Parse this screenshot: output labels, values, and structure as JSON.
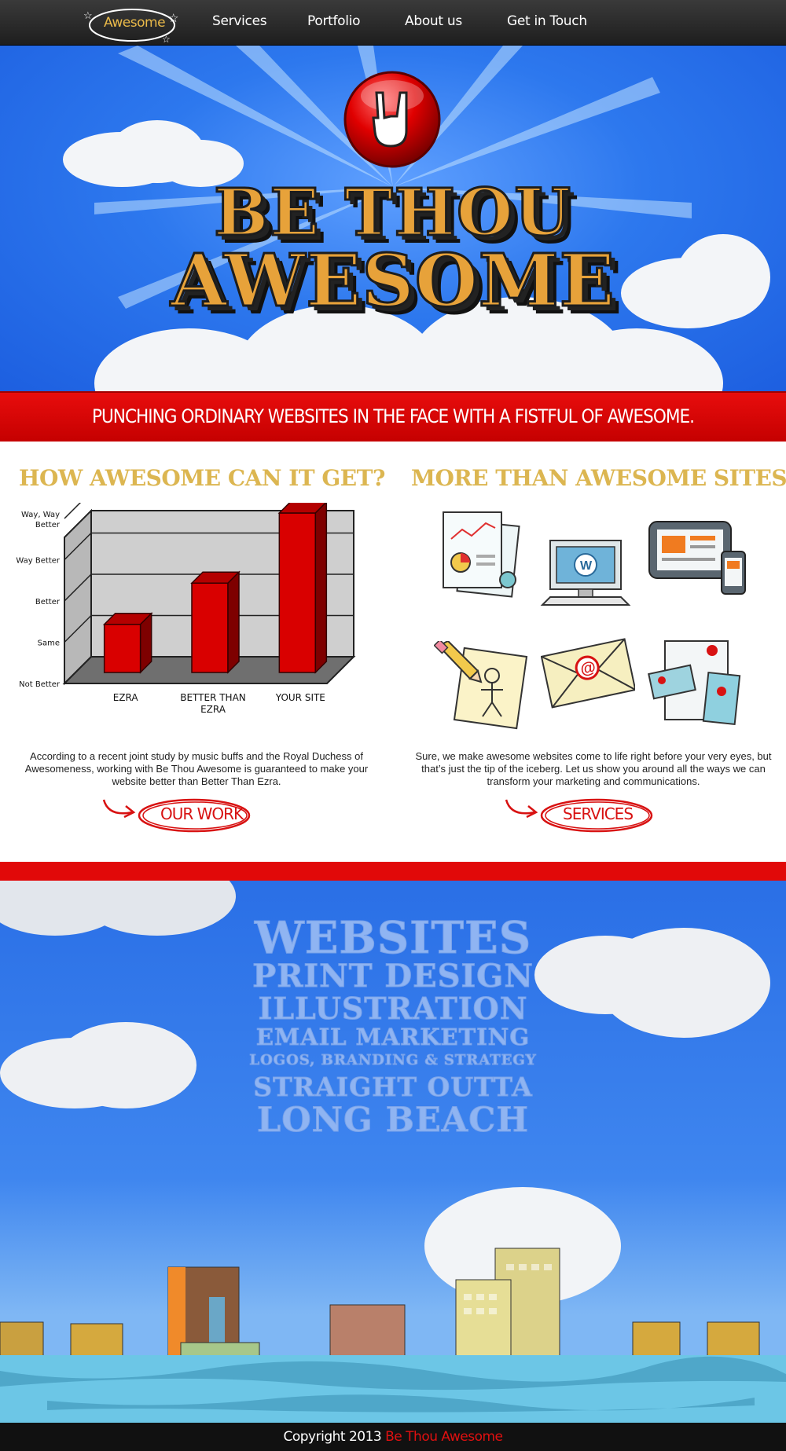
{
  "nav": {
    "logo_text": "Awesome",
    "items": [
      "Services",
      "Portfolio",
      "About us",
      "Get in Touch"
    ]
  },
  "hero": {
    "line1": "BE THOU",
    "line2": "AWESOME"
  },
  "tagline": "Punching ordinary websites in the face with a fistful of awesome.",
  "left": {
    "title": "HOW AWESOME CAN IT GET?",
    "paragraph": "According to a recent joint study by music buffs and the Royal Duchess of Awesomeness, working with Be Thou Awesome is guaranteed to make your website better than Better Than Ezra.",
    "cta": "Our Work"
  },
  "right": {
    "title": "MORE THAN AWESOME SITES",
    "paragraph": "Sure, we make awesome websites come to life right before your very eyes, but that’s just the tip of the iceberg. Let us show you around all the ways we can transform your marketing and communications.",
    "cta": "Services",
    "icons": [
      "report-icon",
      "wordpress-monitor-icon",
      "devices-icon",
      "sketch-icon",
      "email-icon",
      "stationery-icon"
    ]
  },
  "chart_data": {
    "type": "bar",
    "title": "",
    "categories": [
      "EZRA",
      "BETTER THAN EZRA",
      "YOUR SITE"
    ],
    "values": [
      1.3,
      2.3,
      4.0
    ],
    "ylabel": "",
    "xlabel": "",
    "y_ticks": [
      "Not Better",
      "Same",
      "Better",
      "Way Better",
      "Way, Way Better"
    ],
    "ylim": [
      0,
      4
    ],
    "grid": true,
    "colors": {
      "bar": "#d90000",
      "wall": "#cfcfcf",
      "floor": "#6f6f6f"
    }
  },
  "services": [
    {
      "text": "WEBSITES"
    },
    {
      "text": "PRINT DESIGN"
    },
    {
      "text": "ILLUSTRATION"
    },
    {
      "text": "EMAIL MARKETING"
    },
    {
      "text": "LOGOS, BRANDING & STRATEGY"
    },
    {
      "text": "STRAIGHT OUTTA"
    },
    {
      "text": "LONG BEACH"
    }
  ],
  "footer": {
    "prefix": "Copyright 2013 ",
    "brand": "Be Thou Awesome"
  }
}
